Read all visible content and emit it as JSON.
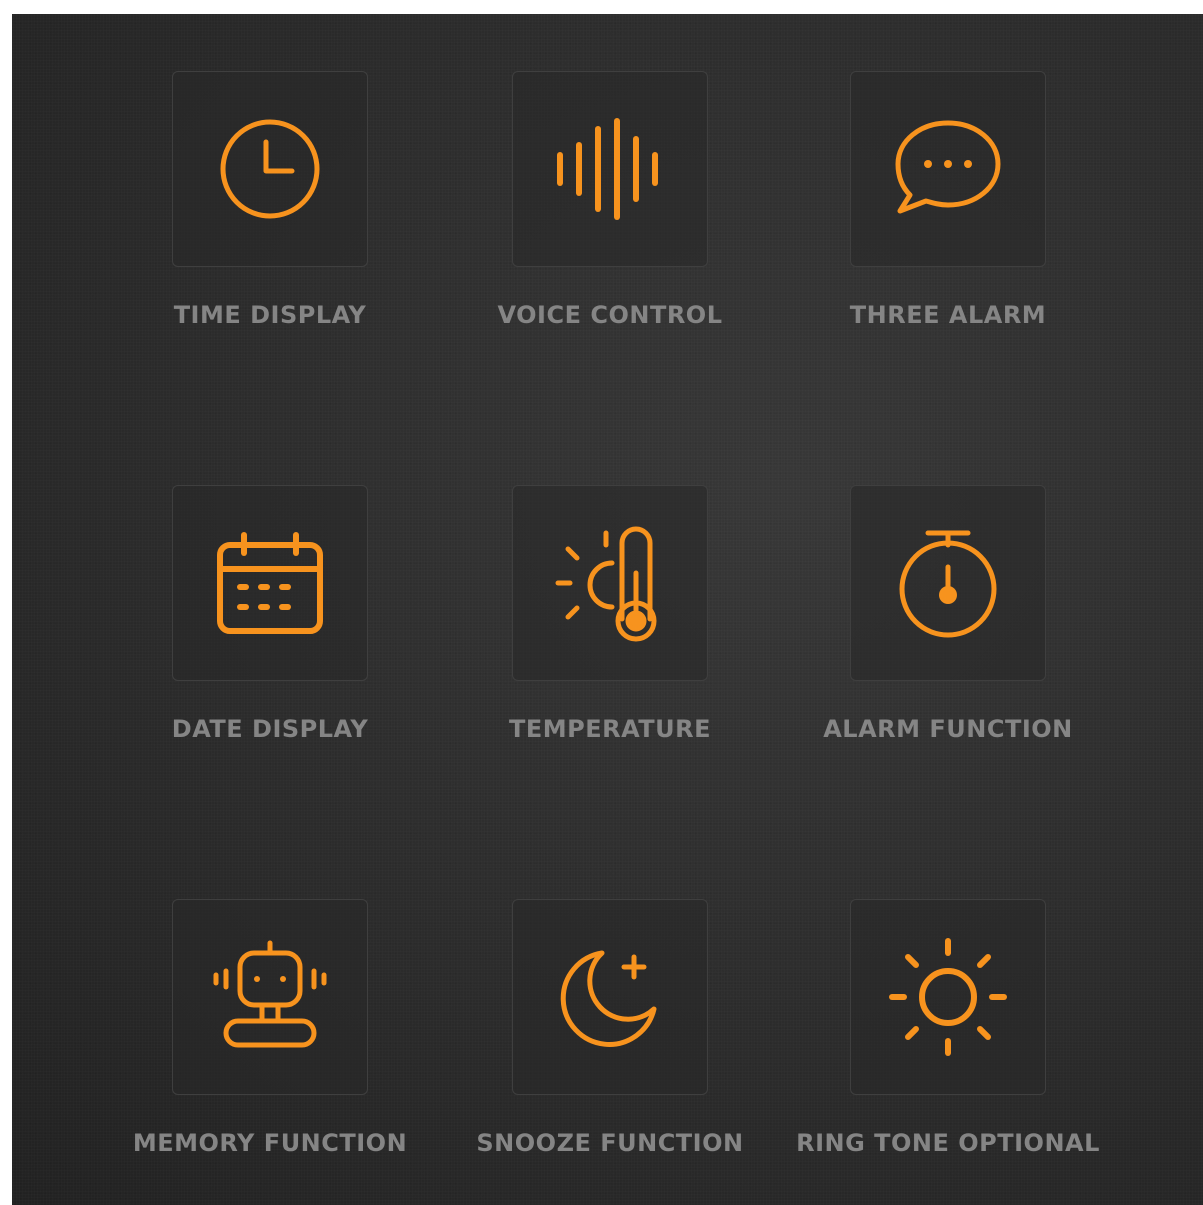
{
  "accent_color": "#f7931e",
  "features": [
    {
      "label": "TIME DISPLAY",
      "icon": "clock-icon"
    },
    {
      "label": "VOICE CONTROL",
      "icon": "sound-wave-icon"
    },
    {
      "label": "THREE ALARM",
      "icon": "chat-bubble-icon"
    },
    {
      "label": "DATE DISPLAY",
      "icon": "calendar-icon"
    },
    {
      "label": "TEMPERATURE",
      "icon": "thermometer-sun-icon"
    },
    {
      "label": "ALARM FUNCTION",
      "icon": "stopwatch-icon"
    },
    {
      "label": "MEMORY FUNCTION",
      "icon": "robot-icon"
    },
    {
      "label": "SNOOZE FUNCTION",
      "icon": "moon-plus-icon"
    },
    {
      "label": "RING TONE OPTIONAL",
      "icon": "sun-icon"
    }
  ]
}
